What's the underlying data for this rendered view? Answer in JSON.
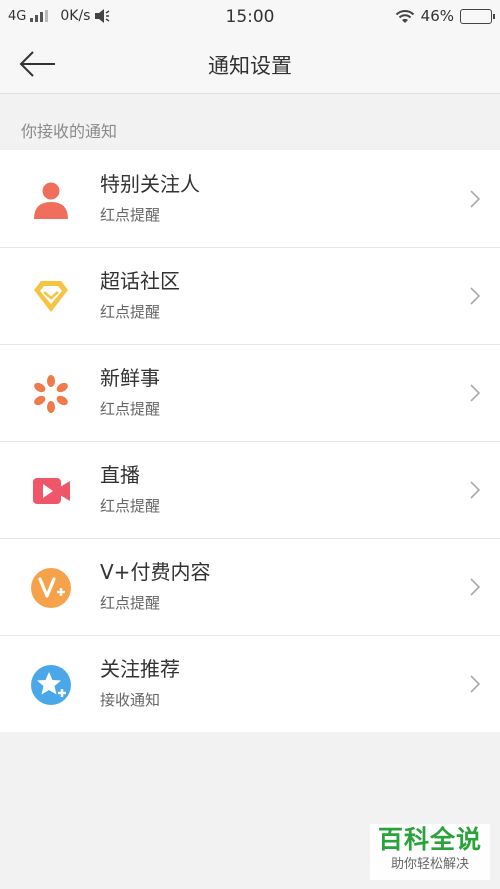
{
  "status": {
    "network": "4G",
    "speed": "0K/s",
    "time": "15:00",
    "battery": "46%",
    "battery_level": 0.46
  },
  "header": {
    "title": "通知设置"
  },
  "section": {
    "label": "你接收的通知"
  },
  "items": [
    {
      "title": "特别关注人",
      "subtitle": "红点提醒",
      "icon": "person-icon",
      "color": "#ef6e5c"
    },
    {
      "title": "超话社区",
      "subtitle": "红点提醒",
      "icon": "diamond-icon",
      "color": "#f6c343"
    },
    {
      "title": "新鲜事",
      "subtitle": "红点提醒",
      "icon": "petals-icon",
      "color": "#f07a4a"
    },
    {
      "title": "直播",
      "subtitle": "红点提醒",
      "icon": "video-camera-icon",
      "color": "#f0566a"
    },
    {
      "title": "V+付费内容",
      "subtitle": "红点提醒",
      "icon": "v-plus-icon",
      "color": "#f6a24a"
    },
    {
      "title": "关注推荐",
      "subtitle": "接收通知",
      "icon": "star-plus-icon",
      "color": "#4aa8e8"
    }
  ],
  "watermark": {
    "title": "百科全说",
    "subtitle": "助你轻松解决"
  }
}
